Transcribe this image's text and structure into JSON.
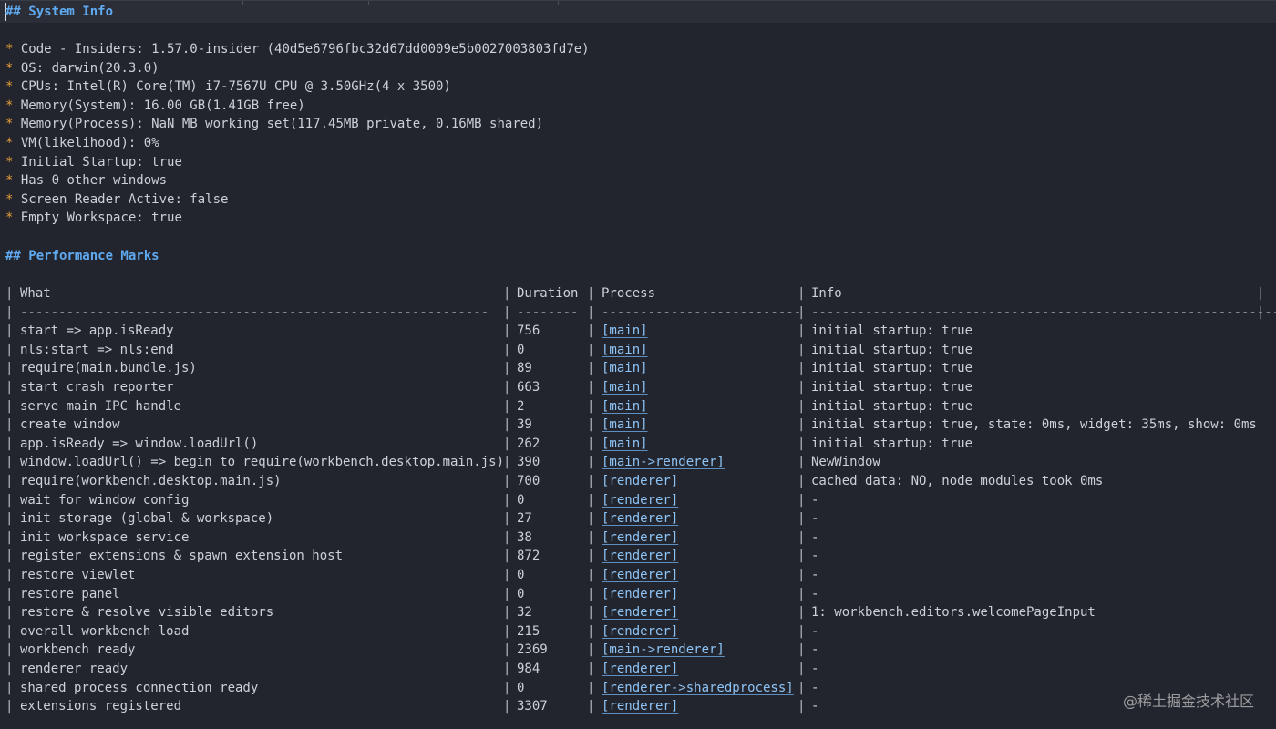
{
  "system_info": {
    "heading": "## System Info",
    "bullet": "*",
    "items": [
      "Code - Insiders: 1.57.0-insider (40d5e6796fbc32d67dd0009e5b0027003803fd7e)",
      "OS: darwin(20.3.0)",
      "CPUs: Intel(R) Core(TM) i7-7567U CPU @ 3.50GHz(4 x 3500)",
      "Memory(System): 16.00 GB(1.41GB free)",
      "Memory(Process): NaN MB working set(117.45MB private, 0.16MB shared)",
      "VM(likelihood): 0%",
      "Initial Startup: true",
      "Has 0 other windows",
      "Screen Reader Active: false",
      "Empty Workspace: true"
    ]
  },
  "performance_marks": {
    "heading": "## Performance Marks",
    "pipe": "|",
    "headers": {
      "what": "What",
      "duration": "Duration",
      "process": "Process",
      "info": "Info"
    },
    "separators": {
      "what": "-------------------------------------------------------------",
      "duration": "--------",
      "process": "--------------------------",
      "info": "-----------------------------------------------------------------"
    },
    "rows": [
      {
        "what": "start => app.isReady",
        "duration": "756",
        "process": "[main]",
        "info": "initial startup: true"
      },
      {
        "what": "nls:start => nls:end",
        "duration": "0",
        "process": "[main]",
        "info": "initial startup: true"
      },
      {
        "what": "require(main.bundle.js)",
        "duration": "89",
        "process": "[main]",
        "info": "initial startup: true"
      },
      {
        "what": "start crash reporter",
        "duration": "663",
        "process": "[main]",
        "info": "initial startup: true"
      },
      {
        "what": "serve main IPC handle",
        "duration": "2",
        "process": "[main]",
        "info": "initial startup: true"
      },
      {
        "what": "create window",
        "duration": "39",
        "process": "[main]",
        "info": "initial startup: true, state: 0ms, widget: 35ms, show: 0ms"
      },
      {
        "what": "app.isReady => window.loadUrl()",
        "duration": "262",
        "process": "[main]",
        "info": "initial startup: true"
      },
      {
        "what": "window.loadUrl() => begin to require(workbench.desktop.main.js)",
        "duration": "390",
        "process": "[main->renderer]",
        "info": "NewWindow"
      },
      {
        "what": "require(workbench.desktop.main.js)",
        "duration": "700",
        "process": "[renderer]",
        "info": "cached data: NO, node_modules took 0ms"
      },
      {
        "what": "wait for window config",
        "duration": "0",
        "process": "[renderer]",
        "info": "-"
      },
      {
        "what": "init storage (global & workspace)",
        "duration": "27",
        "process": "[renderer]",
        "info": "-"
      },
      {
        "what": "init workspace service",
        "duration": "38",
        "process": "[renderer]",
        "info": "-"
      },
      {
        "what": "register extensions & spawn extension host",
        "duration": "872",
        "process": "[renderer]",
        "info": "-"
      },
      {
        "what": "restore viewlet",
        "duration": "0",
        "process": "[renderer]",
        "info": "-"
      },
      {
        "what": "restore panel",
        "duration": "0",
        "process": "[renderer]",
        "info": "-"
      },
      {
        "what": "restore & resolve visible editors",
        "duration": "32",
        "process": "[renderer]",
        "info": "1: workbench.editors.welcomePageInput"
      },
      {
        "what": "overall workbench load",
        "duration": "215",
        "process": "[renderer]",
        "info": "-"
      },
      {
        "what": "workbench ready",
        "duration": "2369",
        "process": "[main->renderer]",
        "info": "-"
      },
      {
        "what": "renderer ready",
        "duration": "984",
        "process": "[renderer]",
        "info": "-"
      },
      {
        "what": "shared process connection ready",
        "duration": "0",
        "process": "[renderer->sharedprocess]",
        "info": "-"
      },
      {
        "what": "extensions registered",
        "duration": "3307",
        "process": "[renderer]",
        "info": "-"
      }
    ]
  },
  "watermark": "@稀土掘金技术社区",
  "colors": {
    "background": "#22252d",
    "heading": "#5fa9f0",
    "bullet": "#e59d3a",
    "text": "#ccd0d8",
    "link": "#8ec3f5"
  }
}
